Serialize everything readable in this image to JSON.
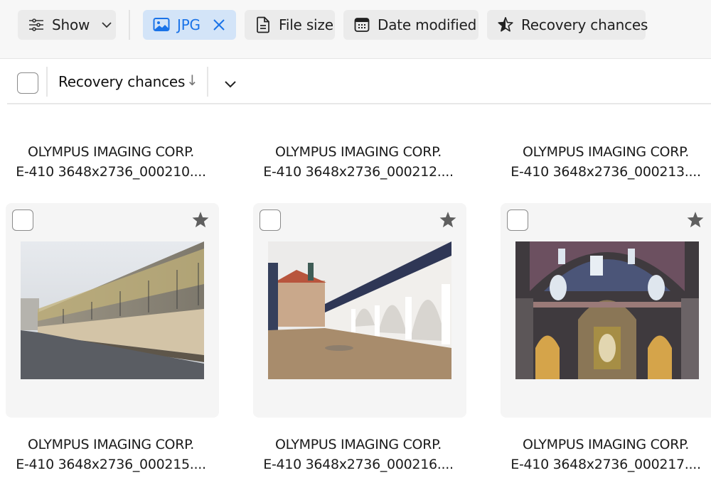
{
  "toolbar": {
    "show": {
      "label": "Show",
      "icon": "sliders-icon",
      "dropdown_icon": "chevron-down-icon"
    },
    "filters": [
      {
        "label": "JPG",
        "icon": "image-icon",
        "active": true,
        "remove_icon": "close-icon"
      },
      {
        "label": "File size",
        "icon": "document-icon",
        "active": false
      },
      {
        "label": "Date modified",
        "icon": "calendar-icon",
        "active": false
      },
      {
        "label": "Recovery chances",
        "icon": "half-star-icon",
        "active": false
      }
    ],
    "accent_color": "#1a73e8",
    "active_chip_bg": "#d3e4f8"
  },
  "sort": {
    "label": "Recovery chances",
    "direction_glyph": "↓",
    "direction": "descending"
  },
  "grid": {
    "top_row_captions": [
      {
        "line1": "OLYMPUS IMAGING CORP.",
        "line2": "E-410 3648x2736_000210...."
      },
      {
        "line1": "OLYMPUS IMAGING CORP.",
        "line2": "E-410 3648x2736_000212...."
      },
      {
        "line1": "OLYMPUS IMAGING CORP.",
        "line2": "E-410 3648x2736_000213...."
      }
    ],
    "cards": [
      {
        "thumb": "tiled-mural-wall-street",
        "checked": false,
        "starred": true,
        "line1": "OLYMPUS IMAGING CORP.",
        "line2": "E-410 3648x2736_000215...."
      },
      {
        "thumb": "arcade-courtyard",
        "checked": false,
        "starred": true,
        "line1": "OLYMPUS IMAGING CORP.",
        "line2": "E-410 3648x2736_000216...."
      },
      {
        "thumb": "baroque-church-interior",
        "checked": false,
        "starred": true,
        "line1": "OLYMPUS IMAGING CORP.",
        "line2": "E-410 3648x2736_000217...."
      }
    ]
  }
}
